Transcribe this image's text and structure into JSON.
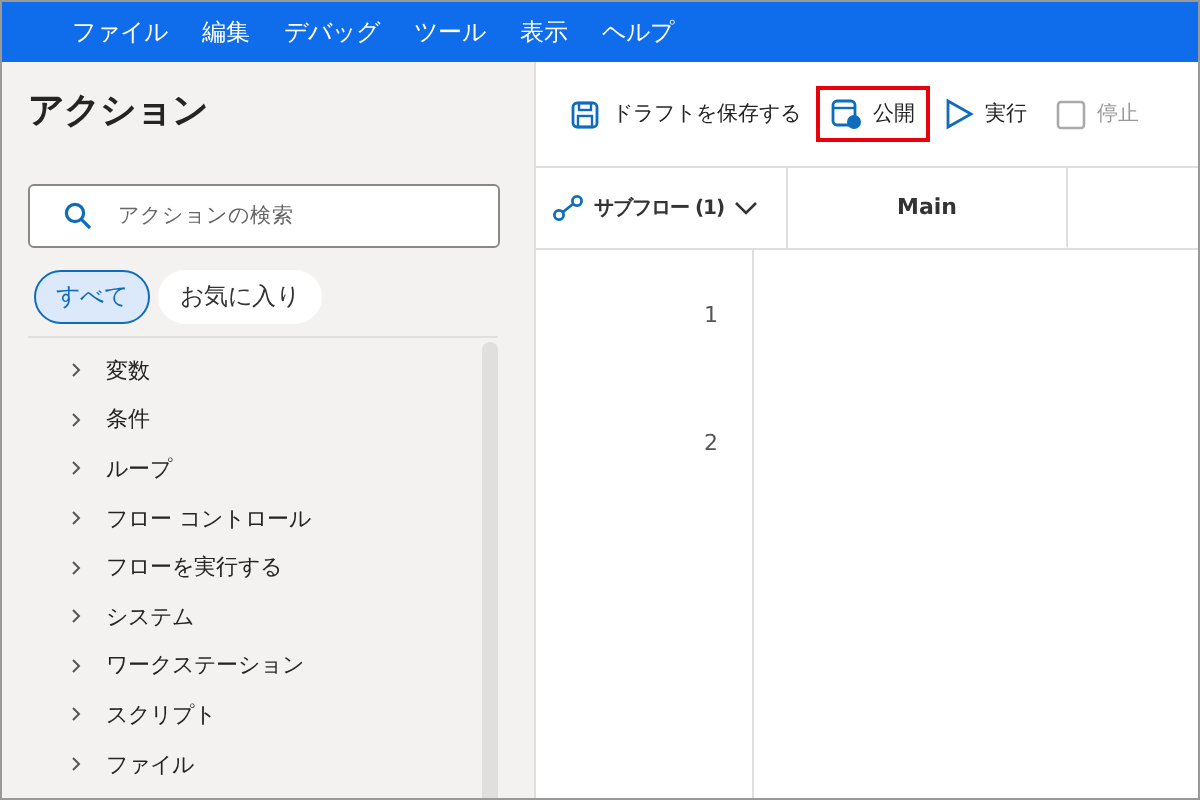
{
  "menu_bar": [
    "ファイル",
    "編集",
    "デバッグ",
    "ツール",
    "表示",
    "ヘルプ"
  ],
  "actions_panel": {
    "title": "アクション",
    "search": {
      "placeholder": "アクションの検索"
    },
    "filters": [
      {
        "label": "すべて",
        "selected": true
      },
      {
        "label": "お気に入り",
        "selected": false
      }
    ],
    "items": [
      {
        "label": "変数",
        "expanded": false
      },
      {
        "label": "条件",
        "expanded": false
      },
      {
        "label": "ループ",
        "expanded": false
      },
      {
        "label": "フロー コントロール",
        "expanded": false
      },
      {
        "label": "フローを実行する",
        "expanded": false
      },
      {
        "label": "システム",
        "expanded": false
      },
      {
        "label": "ワークステーション",
        "expanded": false
      },
      {
        "label": "スクリプト",
        "expanded": false
      },
      {
        "label": "ファイル",
        "expanded": false
      }
    ]
  },
  "toolbar": [
    {
      "kind": "save",
      "label": "ドラフトを保存する",
      "disabled": false,
      "highlighted": false
    },
    {
      "kind": "publish",
      "label": "公開",
      "disabled": false,
      "highlighted": true
    },
    {
      "kind": "run",
      "label": "実行",
      "disabled": false,
      "highlighted": false
    },
    {
      "kind": "stop",
      "label": "停止",
      "disabled": true,
      "highlighted": false
    }
  ],
  "subflows": {
    "label": "サブフロー (1)",
    "tabs": [
      {
        "label": "Main",
        "selected": true
      }
    ]
  },
  "editor": {
    "line_numbers": [
      "1",
      "2"
    ]
  }
}
